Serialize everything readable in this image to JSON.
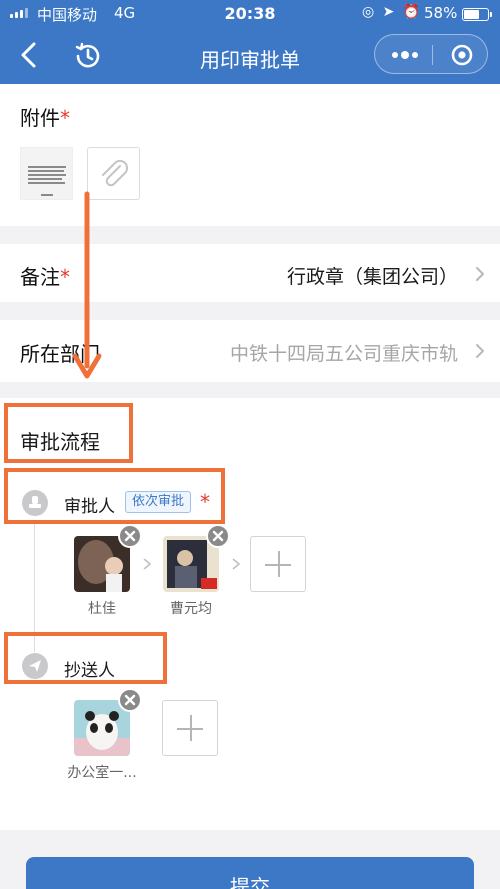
{
  "status_bar": {
    "carrier": "中国移动",
    "network": "4G",
    "time": "20:38",
    "battery": "58%"
  },
  "nav": {
    "title": "用印审批单",
    "back_icon": "chevron-left-icon",
    "history_icon": "clock-history-icon",
    "more_icon": "more-dots-icon",
    "close_icon": "target-close-icon",
    "color": "#3d78c6"
  },
  "attachment": {
    "label": "附件",
    "required_mark": "*",
    "add_icon": "paperclip-icon"
  },
  "remark": {
    "label": "备注",
    "required_mark": "*",
    "value": "行政章（集团公司）"
  },
  "department": {
    "label": "所在部门",
    "value": "中铁十四局五公司重庆市轨"
  },
  "approval": {
    "section_title": "审批流程",
    "approvers": {
      "label": "审批人",
      "tag": "依次审批",
      "required_mark": "*",
      "people": [
        {
          "name": "杜佳"
        },
        {
          "name": "曹元均"
        }
      ]
    },
    "cc": {
      "label": "抄送人",
      "people": [
        {
          "name": "办公室一..."
        }
      ]
    }
  },
  "submit_label": "提交",
  "colors": {
    "accent": "#3d78c6",
    "required": "#e23b2e",
    "annotation": "#f0703a"
  }
}
